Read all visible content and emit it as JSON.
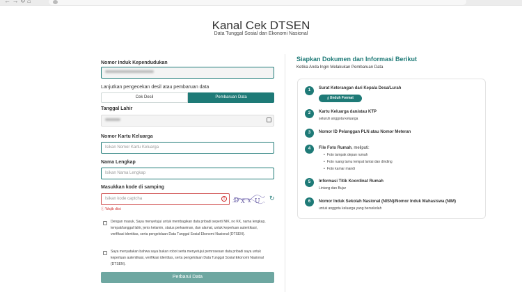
{
  "header": {
    "title": "Kanal Cek DTSEN",
    "subtitle": "Data Tunggal Sosial dan Ekonomi Nasional"
  },
  "form": {
    "nik_label": "Nomor Induk Kependudukan",
    "mode_label": "Lanjutkan pengecekan desil atau pembaruan data",
    "mode_options": [
      "Cek Desil",
      "Pembaruan Data"
    ],
    "mode_selected": "Pembaruan Data",
    "dob_label": "Tanggal Lahir",
    "kk_label": "Nomor Kartu Keluarga",
    "kk_placeholder": "Isikan Nomor Kartu Keluarga",
    "name_label": "Nama Lengkap",
    "name_placeholder": "Isikan Nama Lengkap",
    "captcha_label": "Masukkan kode di samping",
    "captcha_placeholder": "Isikan kode captcha",
    "captcha_error": "Wajib diisi",
    "consent_1": "Dengan masuk, Saya menyetujui untuk membagikan data pribadi seperti NIK, no KK, nama lengkap, tempat/tanggal lahir, jenis kelamin, status perkawinan, dan alamat, untuk keperluan autentikasi, verifikasi identitas, serta pengelolaan Data Tunggal Sosial Ekonomi Nasional (DTSEN).",
    "consent_2": "Saya menyatakan bahwa saya bukan robot serta menyetujui pemrosesan data pribadi saya untuk keperluan autentikasi, verifikasi identitas, serta pengelolaan Data Tunggal Sosial Ekonomi Nasional (DTSEN).",
    "submit_label": "Perbarui Data"
  },
  "info": {
    "title": "Siapkan Dokumen dan Informasi Berikut",
    "subtitle": "Ketika Anda Ingin Melakukan Pembaruan Data",
    "download_label": "Unduh Format",
    "steps": [
      {
        "num": "1",
        "title": "Surat Keterangan dari Kepala Desa/Lurah",
        "title_suffix": "",
        "desc": ""
      },
      {
        "num": "2",
        "title": "Kartu Keluarga dan/atau KTP",
        "title_suffix": "",
        "desc": "seluruh anggota keluarga"
      },
      {
        "num": "3",
        "title": "Nomor ID Pelanggan PLN atau Nomor Meteran",
        "title_suffix": "",
        "desc": ""
      },
      {
        "num": "4",
        "title": "File Foto Rumah",
        "title_suffix": ", meliputi:",
        "desc": ""
      },
      {
        "num": "5",
        "title": "Informasi Titik Koordinat Rumah",
        "title_suffix": "",
        "desc": "Lintang dan Bujur"
      },
      {
        "num": "6",
        "title": "Nomor Induk Sekolah Nasional (NISN)/Nomor Induk Mahasiswa (NIM)",
        "title_suffix": "",
        "desc": "untuk anggota keluarga yang bersekolah"
      }
    ],
    "photo_items": [
      "Foto tampak depan rumah",
      "Foto ruang tamu tempat lantai dan dinding",
      "Foto kamar mandi"
    ]
  },
  "colors": {
    "primary": "#1e7a77",
    "primary_light": "#6ea7a1",
    "error": "#d03030"
  }
}
